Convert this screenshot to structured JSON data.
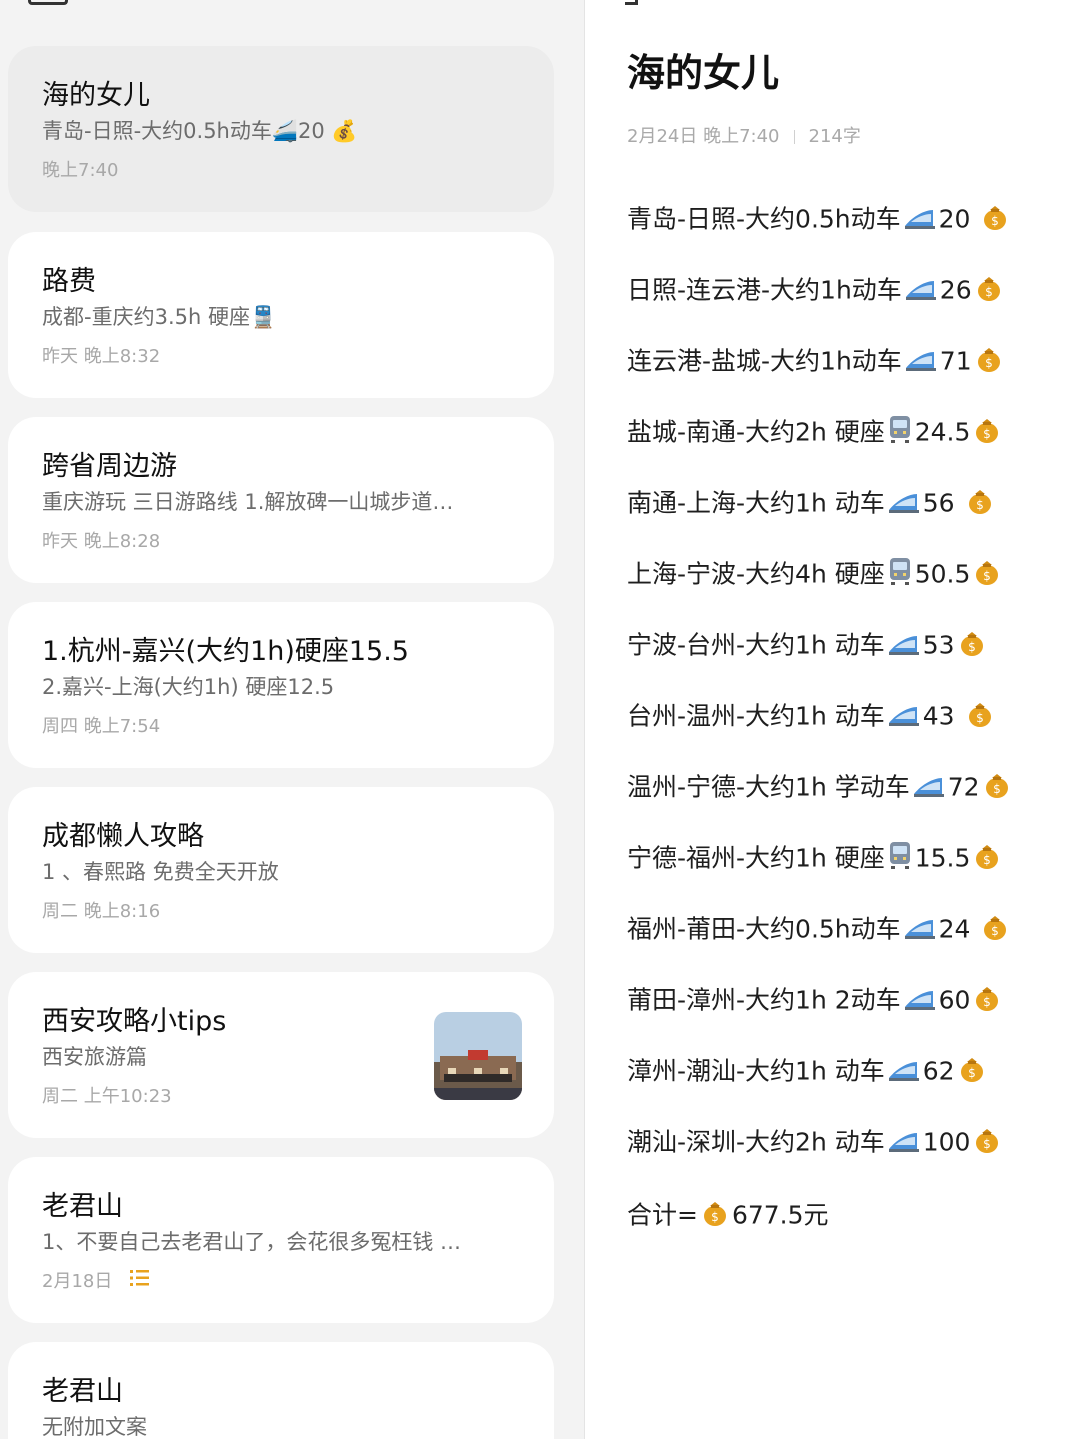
{
  "list": {
    "notes": [
      {
        "title": "海的女儿",
        "snippet": "青岛-日照-大约0.5h动车🚄20 💰",
        "time": "晚上7:40"
      },
      {
        "title": "路费",
        "snippet": "成都-重庆约3.5h 硬座🚆",
        "time": "昨天 晚上8:32"
      },
      {
        "title": "跨省周边游",
        "snippet": "重庆游玩 三日游路线 1.解放碑一山城步道…",
        "time": "昨天 晚上8:28"
      },
      {
        "title": "1.杭州-嘉兴(大约1h)硬座15.5",
        "snippet": "2.嘉兴-上海(大约1h) 硬座12.5",
        "time": "周四 晚上7:54"
      },
      {
        "title": "成都懒人攻略",
        "snippet": "1 、春熙路 免费全天开放",
        "time": "周二 晚上8:16"
      },
      {
        "title": "西安攻略小tips",
        "snippet": "西安旅游篇",
        "time": "周二 上午10:23"
      },
      {
        "title": "老君山",
        "snippet": "1、不要自己去老君山了，会花很多冤枉钱 …",
        "time": "2月18日"
      },
      {
        "title": "老君山",
        "snippet": "无附加文案",
        "time": ""
      }
    ]
  },
  "detail": {
    "title": "海的女儿",
    "date": "2月24日 晚上7:40",
    "word_count": "214字",
    "lines": [
      {
        "text": "青岛-日照-大约0.5h动车",
        "icon": "bullet-train-icon",
        "price": "20 ",
        "money": true
      },
      {
        "text": "日照-连云港-大约1h动车",
        "icon": "bullet-train-icon",
        "price": "26",
        "money": true
      },
      {
        "text": " 连云港-盐城-大约1h动车",
        "icon": "bullet-train-icon",
        "price": "71",
        "money": true
      },
      {
        "text": " 盐城-南通-大约2h 硬座",
        "icon": "train-icon",
        "price": "24.5",
        "money": true
      },
      {
        "text": " 南通-上海-大约1h 动车",
        "icon": "bullet-train-icon",
        "price": "56 ",
        "money": true
      },
      {
        "text": "上海-宁波-大约4h 硬座",
        "icon": "train-icon",
        "price": "50.5",
        "money": true
      },
      {
        "text": " 宁波-台州-大约1h 动车",
        "icon": "bullet-train-icon",
        "price": "53",
        "money": true
      },
      {
        "text": " 台州-温州-大约1h 动车",
        "icon": "bullet-train-icon",
        "price": "43 ",
        "money": true
      },
      {
        "text": "温州-宁德-大约1h 学动车",
        "icon": "bullet-train-icon",
        "price": "72",
        "money": true
      },
      {
        "text": " 宁德-福州-大约1h 硬座",
        "icon": "train-icon",
        "price": "15.5",
        "money": true
      },
      {
        "text": " 福州-莆田-大约0.5h动车",
        "icon": "bullet-train-icon",
        "price": "24 ",
        "money": true
      },
      {
        "text": "莆田-漳州-大约1h 2动车",
        "icon": "bullet-train-icon",
        "price": "60",
        "money": true
      },
      {
        "text": " 漳州-潮汕-大约1h 动车",
        "icon": "bullet-train-icon",
        "price": "62",
        "money": true
      },
      {
        "text": " 潮汕-深圳-大约2h 动车",
        "icon": "bullet-train-icon",
        "price": "100",
        "money": true
      }
    ],
    "total_prefix": " 合计=",
    "total_value": "677.5元"
  },
  "colors": {
    "background": "#f3f3f3",
    "card": "#ffffff",
    "selected_card": "#ececec",
    "muted_text": "#a8a8a8",
    "accent_yellow": "#e8a21e"
  }
}
